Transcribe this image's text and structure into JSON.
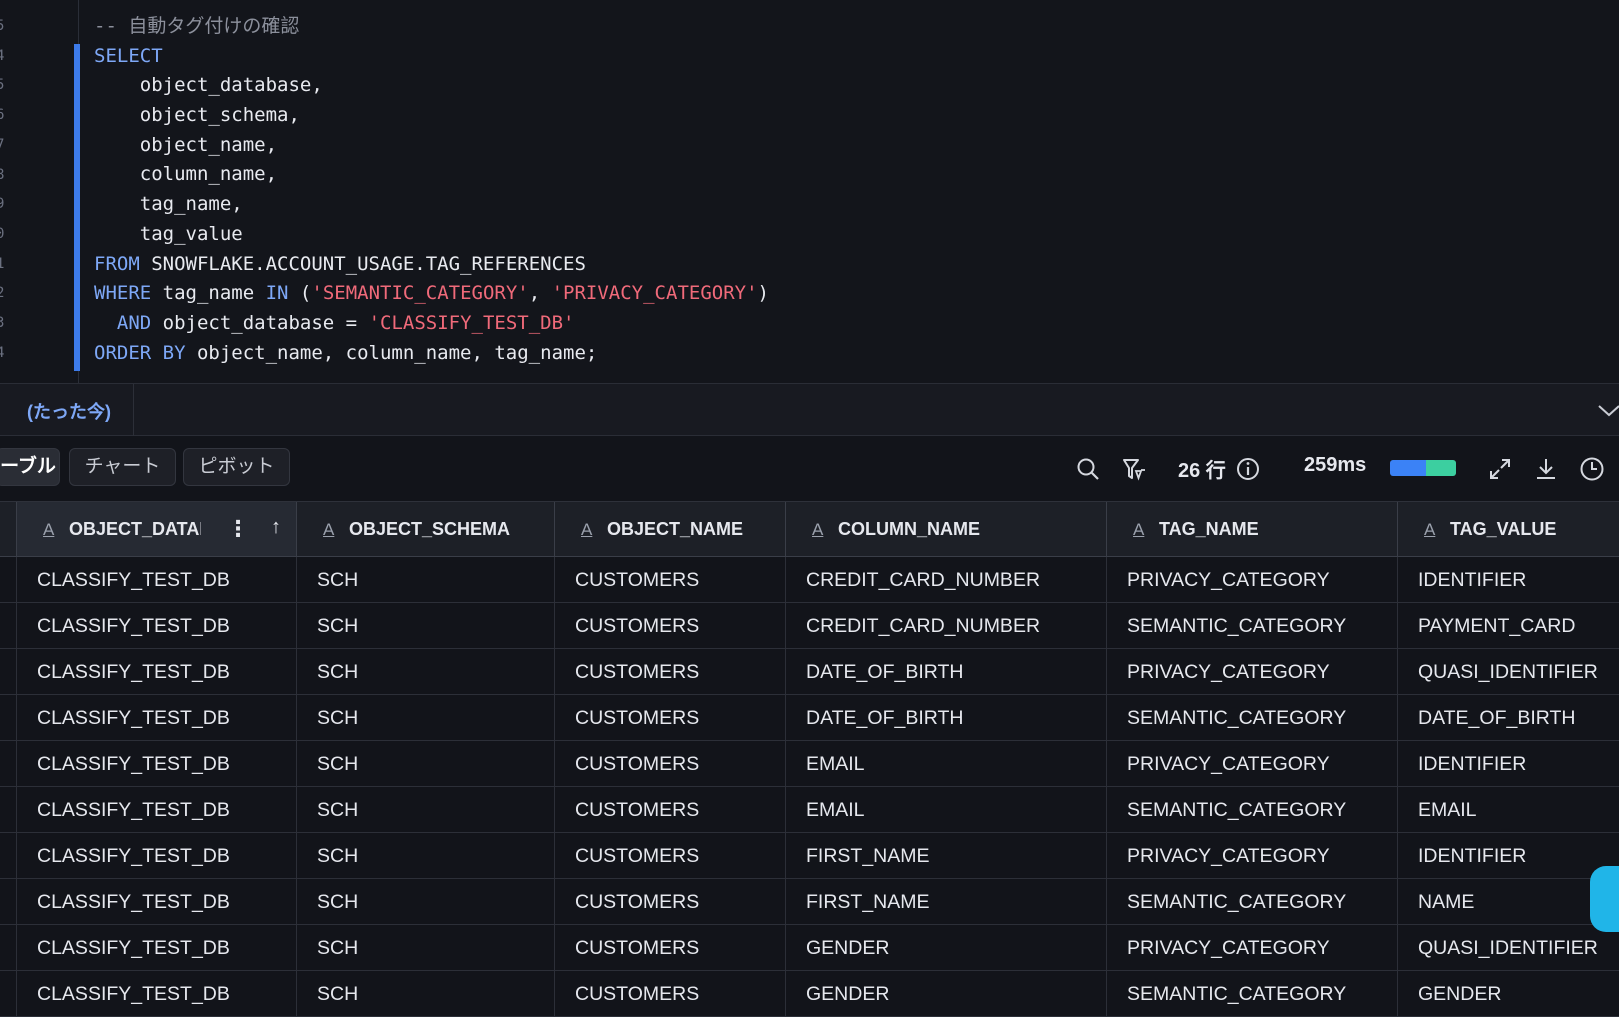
{
  "editor": {
    "line_numbers": [
      "5",
      "4",
      "5",
      "6",
      "7",
      "8",
      "9",
      "0",
      "1",
      "2",
      "3",
      "4"
    ],
    "lines": [
      [
        {
          "t": "-- 自動タグ付けの確認",
          "c": "cmt"
        }
      ],
      [
        {
          "t": "SELECT",
          "c": "kw"
        }
      ],
      [
        {
          "t": "    object_database,",
          "c": ""
        }
      ],
      [
        {
          "t": "    object_schema,",
          "c": ""
        }
      ],
      [
        {
          "t": "    object_name,",
          "c": ""
        }
      ],
      [
        {
          "t": "    column_name,",
          "c": ""
        }
      ],
      [
        {
          "t": "    tag_name,",
          "c": ""
        }
      ],
      [
        {
          "t": "    tag_value",
          "c": ""
        }
      ],
      [
        {
          "t": "FROM",
          "c": "kw"
        },
        {
          "t": " SNOWFLAKE.ACCOUNT_USAGE.TAG_REFERENCES",
          "c": ""
        }
      ],
      [
        {
          "t": "WHERE",
          "c": "kw"
        },
        {
          "t": " tag_name ",
          "c": ""
        },
        {
          "t": "IN",
          "c": "kw"
        },
        {
          "t": " (",
          "c": ""
        },
        {
          "t": "'SEMANTIC_CATEGORY'",
          "c": "str"
        },
        {
          "t": ", ",
          "c": ""
        },
        {
          "t": "'PRIVACY_CATEGORY'",
          "c": "str"
        },
        {
          "t": ")",
          "c": ""
        }
      ],
      [
        {
          "t": "  ",
          "c": ""
        },
        {
          "t": "AND",
          "c": "kw"
        },
        {
          "t": " object_database = ",
          "c": ""
        },
        {
          "t": "'CLASSIFY_TEST_DB'",
          "c": "str"
        }
      ],
      [
        {
          "t": "ORDER BY",
          "c": "kw"
        },
        {
          "t": " object_name, column_name, tag_name;",
          "c": ""
        }
      ]
    ]
  },
  "history": {
    "tab_label": "(たった今)"
  },
  "toolbar": {
    "tabs": [
      {
        "label": "ーブル",
        "active": true
      },
      {
        "label": "チャート",
        "active": false
      },
      {
        "label": "ピボット",
        "active": false
      }
    ],
    "row_count": "26 行",
    "duration": "259ms",
    "perf_split": 0.55,
    "icons": [
      "search-icon",
      "filter-icon",
      "info-icon",
      "expand-icon",
      "download-icon",
      "history-clock-icon"
    ]
  },
  "grid": {
    "columns": [
      "OBJECT_DATAE",
      "OBJECT_SCHEMA",
      "OBJECT_NAME",
      "COLUMN_NAME",
      "TAG_NAME",
      "TAG_VALUE"
    ],
    "rows": [
      [
        "CLASSIFY_TEST_DB",
        "SCH",
        "CUSTOMERS",
        "CREDIT_CARD_NUMBER",
        "PRIVACY_CATEGORY",
        "IDENTIFIER"
      ],
      [
        "CLASSIFY_TEST_DB",
        "SCH",
        "CUSTOMERS",
        "CREDIT_CARD_NUMBER",
        "SEMANTIC_CATEGORY",
        "PAYMENT_CARD"
      ],
      [
        "CLASSIFY_TEST_DB",
        "SCH",
        "CUSTOMERS",
        "DATE_OF_BIRTH",
        "PRIVACY_CATEGORY",
        "QUASI_IDENTIFIER"
      ],
      [
        "CLASSIFY_TEST_DB",
        "SCH",
        "CUSTOMERS",
        "DATE_OF_BIRTH",
        "SEMANTIC_CATEGORY",
        "DATE_OF_BIRTH"
      ],
      [
        "CLASSIFY_TEST_DB",
        "SCH",
        "CUSTOMERS",
        "EMAIL",
        "PRIVACY_CATEGORY",
        "IDENTIFIER"
      ],
      [
        "CLASSIFY_TEST_DB",
        "SCH",
        "CUSTOMERS",
        "EMAIL",
        "SEMANTIC_CATEGORY",
        "EMAIL"
      ],
      [
        "CLASSIFY_TEST_DB",
        "SCH",
        "CUSTOMERS",
        "FIRST_NAME",
        "PRIVACY_CATEGORY",
        "IDENTIFIER"
      ],
      [
        "CLASSIFY_TEST_DB",
        "SCH",
        "CUSTOMERS",
        "FIRST_NAME",
        "SEMANTIC_CATEGORY",
        "NAME"
      ],
      [
        "CLASSIFY_TEST_DB",
        "SCH",
        "CUSTOMERS",
        "GENDER",
        "PRIVACY_CATEGORY",
        "QUASI_IDENTIFIER"
      ],
      [
        "CLASSIFY_TEST_DB",
        "SCH",
        "CUSTOMERS",
        "GENDER",
        "SEMANTIC_CATEGORY",
        "GENDER"
      ]
    ]
  },
  "colors": {
    "accent": "#3d7bea",
    "keyword": "#7ea8f7",
    "string": "#f06a7a",
    "comment": "#8c909c",
    "perf_blue": "#3b82f6",
    "perf_green": "#3ccfa0"
  }
}
